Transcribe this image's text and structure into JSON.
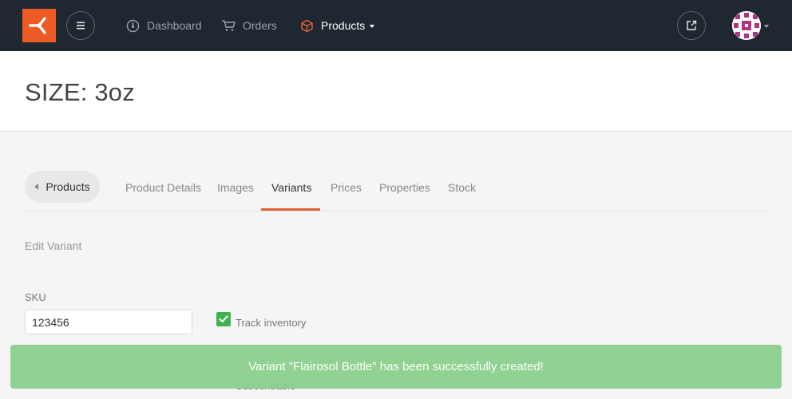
{
  "navbar": {
    "dashboard_label": "Dashboard",
    "orders_label": "Orders",
    "products_label": "Products",
    "logo_color": "#ee5a24",
    "background": "#1f2830"
  },
  "header": {
    "title": "SIZE: 3oz"
  },
  "tabs": {
    "back_label": "Products",
    "items": [
      "Product Details",
      "Images",
      "Variants",
      "Prices",
      "Properties",
      "Stock"
    ],
    "active": "Variants",
    "accent": "#e0603a"
  },
  "form": {
    "section_title": "Edit Variant",
    "sku_label": "SKU",
    "sku_value": "123456",
    "track_inventory_label": "Track inventory",
    "track_inventory_checked": true,
    "subscribable_label": "Subscribable",
    "subscribable_checked": false
  },
  "toast": {
    "message": "Variant \"Flairosol Bottle\" has been successfully created!",
    "color": "#8dd18f"
  }
}
